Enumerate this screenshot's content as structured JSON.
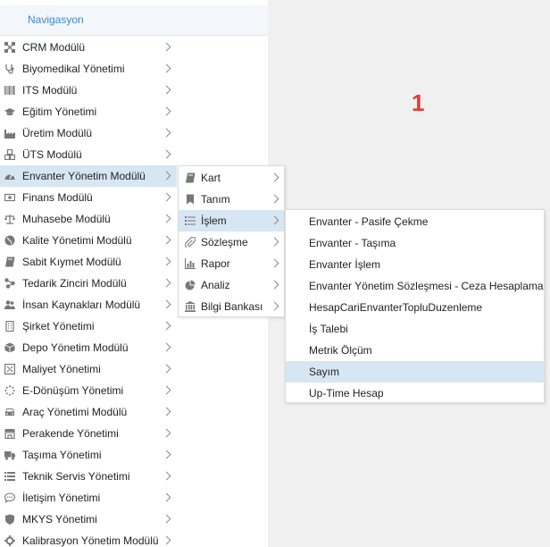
{
  "nav": {
    "title": "Navigasyon",
    "items": [
      {
        "label": "CRM Modülü",
        "icon": "network-icon"
      },
      {
        "label": "Biyomedikal Yönetimi",
        "icon": "stethoscope-icon"
      },
      {
        "label": "ITS Modülü",
        "icon": "barcode-icon"
      },
      {
        "label": "Eğitim Yönetimi",
        "icon": "graduation-cap-icon"
      },
      {
        "label": "Üretim Modülü",
        "icon": "factory-icon"
      },
      {
        "label": "ÜTS Modülü",
        "icon": "cubes-icon"
      },
      {
        "label": "Envanter Yönetim Modülü",
        "icon": "dashboard-icon"
      },
      {
        "label": "Finans Modülü",
        "icon": "money-icon"
      },
      {
        "label": "Muhasebe Modülü",
        "icon": "balance-scale-icon"
      },
      {
        "label": "Kalite Yönetimi Modülü",
        "icon": "globe-icon"
      },
      {
        "label": "Sabit Kıymet Modülü",
        "icon": "book-icon"
      },
      {
        "label": "Tedarik Zinciri Modülü",
        "icon": "sitemap-icon"
      },
      {
        "label": "İnsan Kaynakları Modülü",
        "icon": "users-icon"
      },
      {
        "label": "Şirket Yönetimi",
        "icon": "building-icon"
      },
      {
        "label": "Depo Yönetim Modülü",
        "icon": "box-icon"
      },
      {
        "label": "Maliyet Yönetimi",
        "icon": "calculator-icon"
      },
      {
        "label": "E-Dönüşüm Yönetimi",
        "icon": "spinner-icon"
      },
      {
        "label": "Araç Yönetimi Modülü",
        "icon": "car-icon"
      },
      {
        "label": "Perakende Yönetimi",
        "icon": "store-icon"
      },
      {
        "label": "Taşıma Yönetimi",
        "icon": "truck-icon"
      },
      {
        "label": "Teknik Servis Yönetimi",
        "icon": "list-icon"
      },
      {
        "label": "İletişim Yönetimi",
        "icon": "comment-icon"
      },
      {
        "label": "MKYS Yönetimi",
        "icon": "shield-icon"
      },
      {
        "label": "Kalibrasyon Yönetim Modülü",
        "icon": "settings-icon"
      }
    ],
    "active_index": 6
  },
  "submenu": {
    "items": [
      {
        "label": "Kart",
        "icon": "book-icon"
      },
      {
        "label": "Tanım",
        "icon": "bookmark-icon"
      },
      {
        "label": "İşlem",
        "icon": "list-icon"
      },
      {
        "label": "Sözleşme",
        "icon": "paperclip-icon"
      },
      {
        "label": "Rapor",
        "icon": "bar-chart-icon"
      },
      {
        "label": "Analiz",
        "icon": "pie-chart-icon"
      },
      {
        "label": "Bilgi Bankası",
        "icon": "bank-icon"
      }
    ],
    "active_index": 2
  },
  "third_menu": {
    "items": [
      "Envanter - Pasife Çekme",
      "Envanter - Taşıma",
      "Envanter İşlem",
      "Envanter Yönetim Sözleşmesi - Ceza Hesaplama",
      "HesapCariEnvanterTopluDuzenleme",
      "İş Talebi",
      "Metrik Ölçüm",
      "Sayım",
      "Up-Time Hesap"
    ],
    "active_index": 7
  },
  "marker": "1",
  "colors": {
    "accent": "#3f89c9",
    "highlight": "#d6e6f3",
    "marker": "#e53935"
  }
}
